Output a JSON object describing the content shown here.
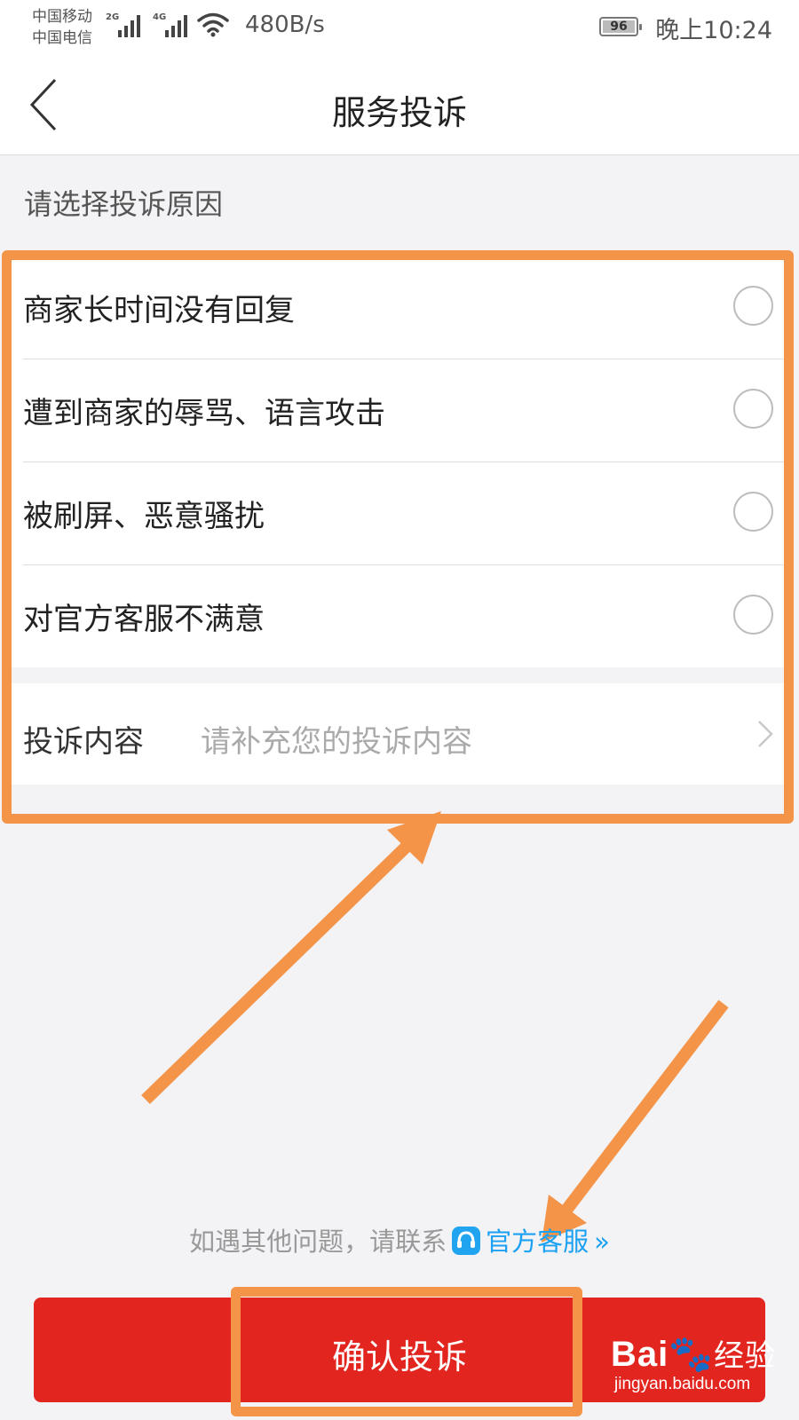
{
  "status_bar": {
    "carrier_1": "中国移动",
    "carrier_2": "中国电信",
    "net_1": "2G",
    "net_2": "4G",
    "speed": "480B/s",
    "battery": "96",
    "time": "晚上10:24"
  },
  "nav": {
    "back_icon": "chevron-left-icon",
    "title": "服务投诉"
  },
  "section_label": "请选择投诉原因",
  "options": [
    {
      "label": "商家长时间没有回复",
      "selected": false
    },
    {
      "label": "遭到商家的辱骂、语言攻击",
      "selected": false
    },
    {
      "label": "被刷屏、恶意骚扰",
      "selected": false
    },
    {
      "label": "对官方客服不满意",
      "selected": false
    }
  ],
  "complaint_content": {
    "label": "投诉内容",
    "placeholder": "请补充您的投诉内容"
  },
  "help": {
    "text": "如遇其他问题，请联系",
    "link": "官方客服",
    "link_icon": "headset-icon",
    "chevron": "»"
  },
  "confirm_button": "确认投诉",
  "annotation_color": "#f39448",
  "accent_color": "#e2261f",
  "link_color": "#1ba1f2",
  "watermark": {
    "brand": "Bai",
    "brand_cn": "经验",
    "site": "jingyan.baidu.com"
  }
}
